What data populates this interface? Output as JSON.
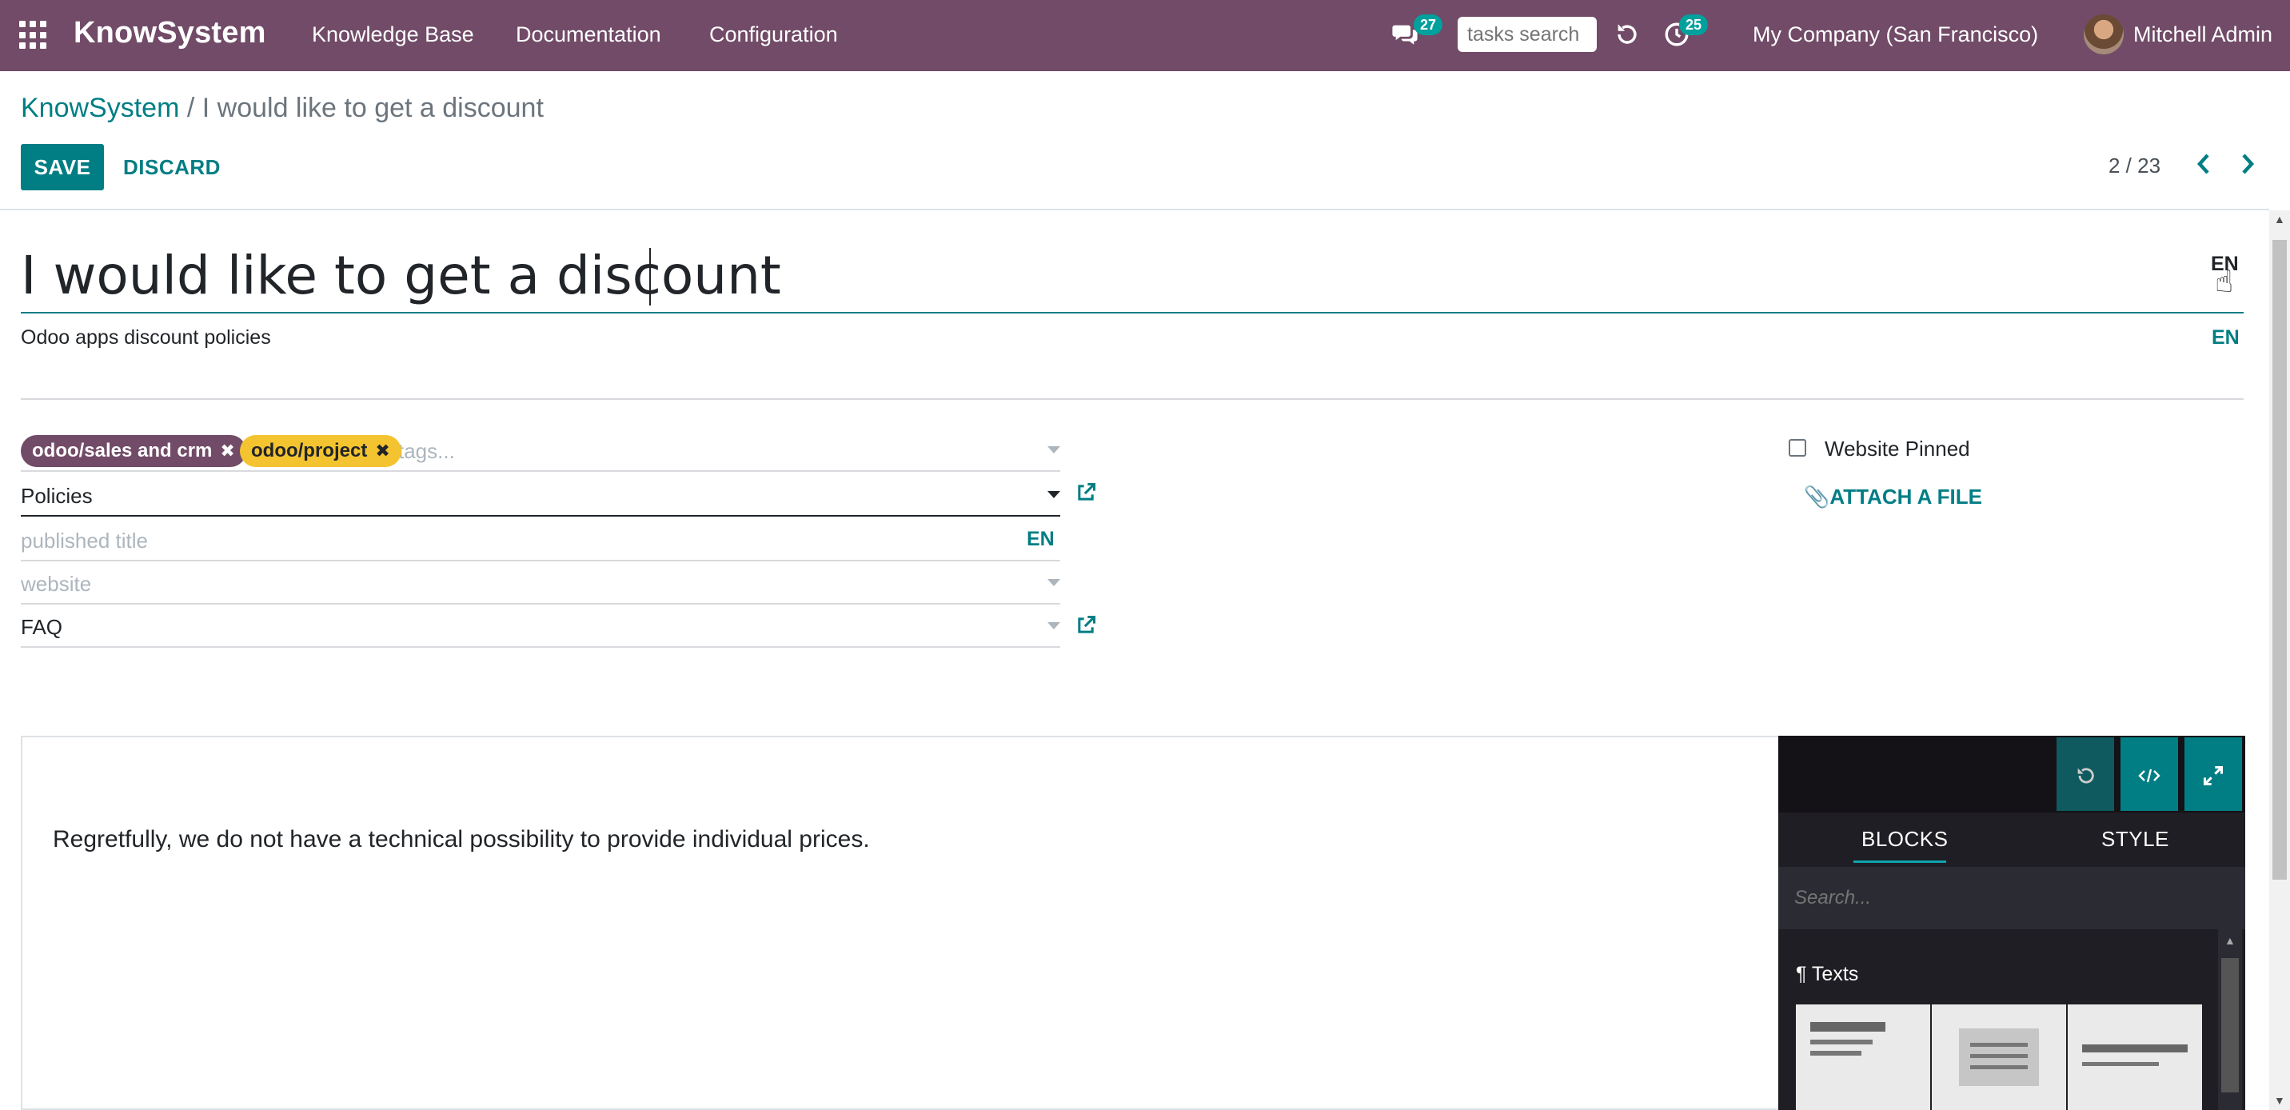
{
  "navbar": {
    "brand": "KnowSystem",
    "menu": [
      "Knowledge Base",
      "Documentation",
      "Configuration"
    ],
    "chat_badge": "27",
    "tasks_search_placeholder": "tasks search",
    "activity_badge": "25",
    "company": "My Company (San Francisco)",
    "user": "Mitchell Admin"
  },
  "breadcrumb": {
    "root": "KnowSystem",
    "separator": " / ",
    "current": "I would like to get a discount"
  },
  "buttons": {
    "save": "SAVE",
    "discard": "DISCARD"
  },
  "pager": {
    "value": "2 / 23"
  },
  "form": {
    "title": "I would like to get a discount",
    "title_lang": "EN",
    "subtitle": "Odoo apps discount policies",
    "subtitle_lang": "EN",
    "tags": [
      {
        "label": "odoo/sales and crm",
        "color": "#714B67",
        "text_color": "#ffffff"
      },
      {
        "label": "odoo/project",
        "color": "#F4C430",
        "text_color": "#212529"
      }
    ],
    "tags_placeholder": "tags...",
    "section": "Policies",
    "published_title_placeholder": "published title",
    "published_title_lang": "EN",
    "website_placeholder": "website",
    "kind": "FAQ",
    "website_pinned_label": "Website Pinned",
    "website_pinned": false,
    "attach_label": "ATTACH A FILE"
  },
  "editor": {
    "body": "Regretfully, we do not have a technical possibility to provide individual prices.",
    "tabs": [
      "BLOCKS",
      "STYLE"
    ],
    "active_tab": "BLOCKS",
    "search_placeholder": "Search...",
    "section_title": "¶ Texts"
  },
  "colors": {
    "brand": "#714B67",
    "accent": "#017e84",
    "teal": "#00A09D"
  }
}
